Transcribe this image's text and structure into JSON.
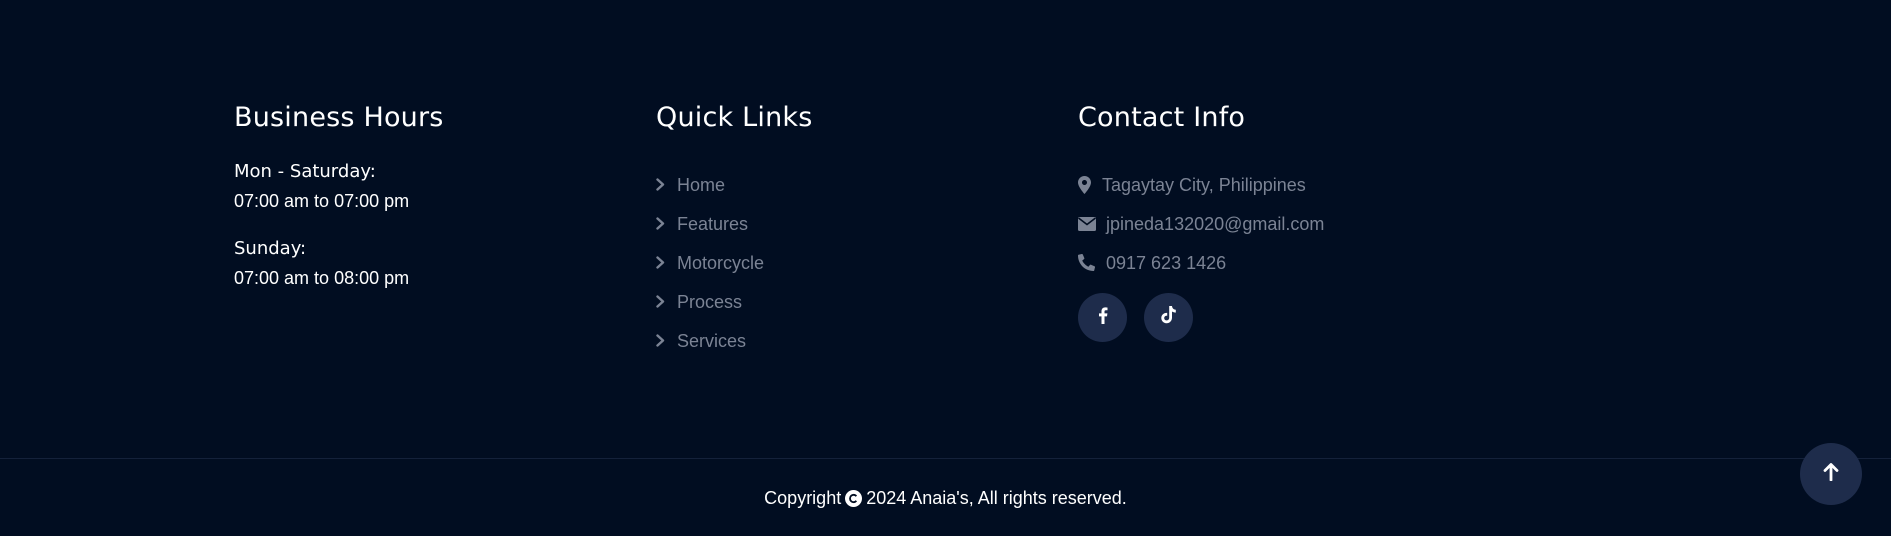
{
  "business_hours": {
    "title": "Business Hours",
    "blocks": [
      {
        "day": "Mon - Saturday:",
        "time": "07:00 am to 07:00 pm"
      },
      {
        "day": "Sunday:",
        "time": "07:00 am to 08:00 pm"
      }
    ]
  },
  "quick_links": {
    "title": "Quick Links",
    "icon": "chevron-right-icon",
    "items": [
      {
        "label": "Home"
      },
      {
        "label": "Features"
      },
      {
        "label": "Motorcycle"
      },
      {
        "label": "Process"
      },
      {
        "label": "Services"
      }
    ]
  },
  "contact_info": {
    "title": "Contact Info",
    "address": {
      "icon": "map-marker-icon",
      "text": "Tagaytay City, Philippines"
    },
    "email": {
      "icon": "envelope-icon",
      "text": "jpineda132020@gmail.com"
    },
    "phone": {
      "icon": "phone-icon",
      "text": "0917 623 1426"
    },
    "socials": [
      {
        "icon": "facebook-icon"
      },
      {
        "icon": "tiktok-icon"
      }
    ]
  },
  "footer": {
    "copyright_prefix": "Copyright",
    "copyright_icon": "copyright-icon",
    "copyright_suffix": "2024 Anaia's, All rights reserved."
  },
  "back_to_top": {
    "icon": "arrow-up-icon"
  },
  "colors": {
    "background": "#010d21",
    "muted_text": "#7b8394",
    "button_bg": "#1e2c4b",
    "text": "#ffffff"
  }
}
